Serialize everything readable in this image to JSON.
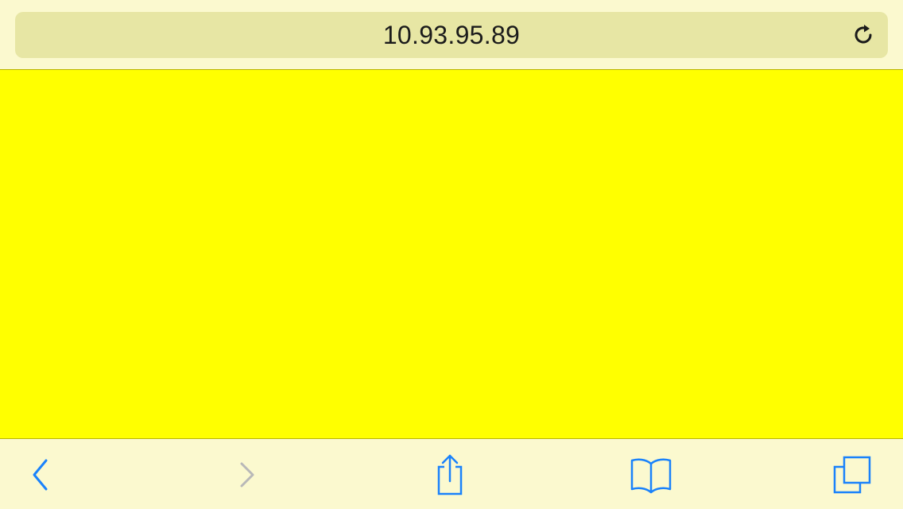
{
  "address_bar": {
    "url": "10.93.95.89",
    "reload_icon": "reload-icon"
  },
  "content": {
    "background_color": "#ffff00"
  },
  "toolbar": {
    "back_icon": "chevron-left-icon",
    "forward_icon": "chevron-right-icon",
    "share_icon": "share-icon",
    "bookmarks_icon": "book-icon",
    "tabs_icon": "tabs-icon",
    "accent_color": "#1a82fb",
    "disabled_color": "#b8b8b8"
  },
  "chrome_color": "#fbf9cf"
}
